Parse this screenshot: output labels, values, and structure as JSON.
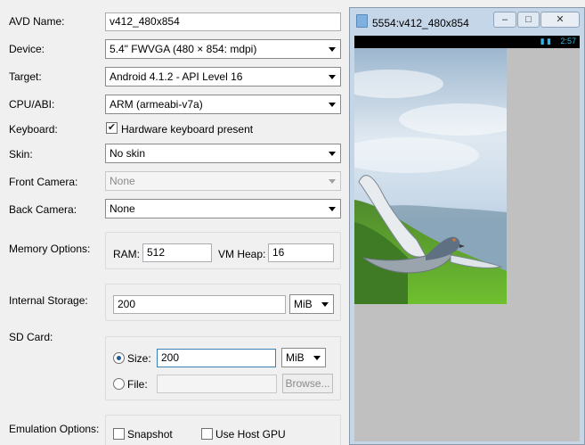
{
  "form": {
    "avd_name": {
      "label": "AVD Name:",
      "value": "v412_480x854"
    },
    "device": {
      "label": "Device:",
      "value": "5.4\" FWVGA (480 × 854: mdpi)"
    },
    "target": {
      "label": "Target:",
      "value": "Android 4.1.2 - API Level 16"
    },
    "cpu_abi": {
      "label": "CPU/ABI:",
      "value": "ARM (armeabi-v7a)"
    },
    "keyboard": {
      "label": "Keyboard:",
      "checkbox_label": "Hardware keyboard present",
      "checked": true
    },
    "skin": {
      "label": "Skin:",
      "value": "No skin"
    },
    "front_camera": {
      "label": "Front Camera:",
      "value": "None",
      "enabled": false
    },
    "back_camera": {
      "label": "Back Camera:",
      "value": "None"
    },
    "memory": {
      "label": "Memory Options:",
      "ram_label": "RAM:",
      "ram_value": "512",
      "vm_heap_label": "VM Heap:",
      "vm_heap_value": "16"
    },
    "internal_storage": {
      "label": "Internal Storage:",
      "value": "200",
      "unit": "MiB"
    },
    "sd_card": {
      "label": "SD Card:",
      "size_label": "Size:",
      "size_value": "200",
      "size_unit": "MiB",
      "size_selected": true,
      "file_label": "File:",
      "file_value": "",
      "browse_label": "Browse..."
    },
    "emulation": {
      "label": "Emulation Options:",
      "snapshot_label": "Snapshot",
      "snapshot_checked": false,
      "host_gpu_label": "Use Host GPU",
      "host_gpu_checked": false
    }
  },
  "emulator": {
    "title": "5554:v412_480x854",
    "controls": {
      "minimize": "–",
      "maximize": "□",
      "close": "✕"
    },
    "status_time": "2:57",
    "status_icons": "▮ ▮",
    "wallpaper_icon": "pigeon-wallpaper"
  },
  "colors": {
    "accent": "#3c7fb1",
    "window_frame": "#c4d6e8",
    "status_blue": "#33b5e5"
  }
}
